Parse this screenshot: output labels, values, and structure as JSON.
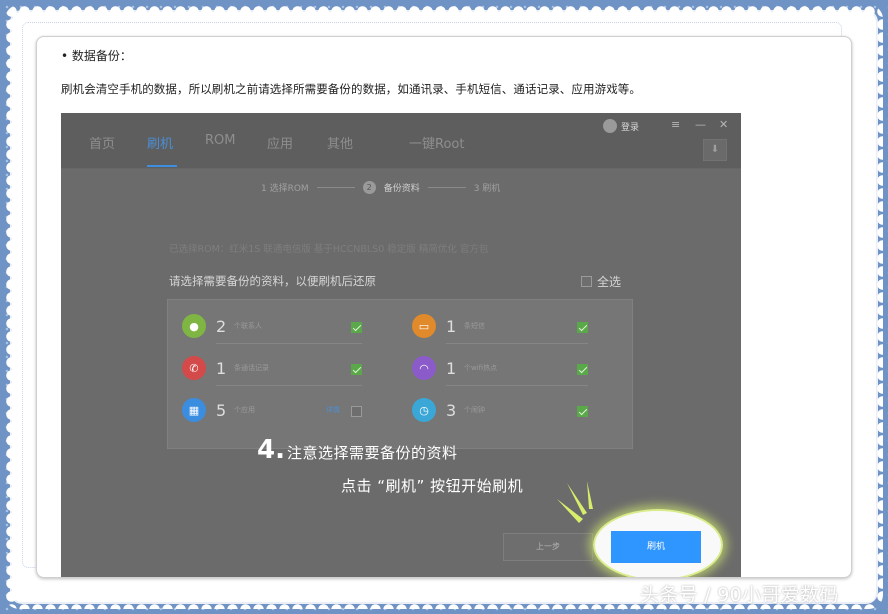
{
  "article": {
    "bullet": "• 数据备份：",
    "description": "刷机会清空手机的数据，所以刷机之前请选择所需要备份的数据，如通讯录、手机短信、通话记录、应用游戏等。"
  },
  "app": {
    "tabs": [
      {
        "label": "首页"
      },
      {
        "label": "刷机"
      },
      {
        "label": "ROM"
      },
      {
        "label": "应用"
      },
      {
        "label": "其他"
      },
      {
        "label": "一键Root"
      }
    ],
    "login_label": "登录",
    "window_controls": {
      "menu": "≡",
      "minimize": "—",
      "close": "✕"
    },
    "download_icon": "⬇",
    "steps": {
      "step1": "1   选择ROM",
      "step2_num": "2",
      "step2": "备份资料",
      "step3": "3   刷机"
    },
    "rom_info": "已选择ROM：红米1S 联通电信版 基于HCCNBLS0 稳定版 精简优化 官方包",
    "choose_title": "请选择需要备份的资料，以便刷机后还原",
    "select_all": "全选",
    "items": [
      {
        "count": "2",
        "label": "个联系人",
        "icon": "person-icon",
        "color": "#7fb543",
        "checked": true
      },
      {
        "count": "1",
        "label": "条短信",
        "icon": "message-icon",
        "color": "#e08a2c",
        "checked": true
      },
      {
        "count": "1",
        "label": "条通话记录",
        "icon": "phone-icon",
        "color": "#d44a4a",
        "checked": true
      },
      {
        "count": "1",
        "label": "个wifi热点",
        "icon": "wifi-icon",
        "color": "#8a5bc9",
        "checked": true
      },
      {
        "count": "5",
        "label": "个应用",
        "icon": "apps-icon",
        "color": "#3b8de0",
        "checked": false,
        "extra": "详情"
      },
      {
        "count": "3",
        "label": "个闹钟",
        "icon": "alarm-icon",
        "color": "#3aa7d6",
        "checked": true
      }
    ],
    "caption": {
      "number": "4.",
      "line1": "注意选择需要备份的资料",
      "line2": "点击 “刷机” 按钮开始刷机"
    },
    "prev_button": "上一步",
    "flash_button": "刷机"
  },
  "watermark": "头条号 / 90小哥爱数码"
}
